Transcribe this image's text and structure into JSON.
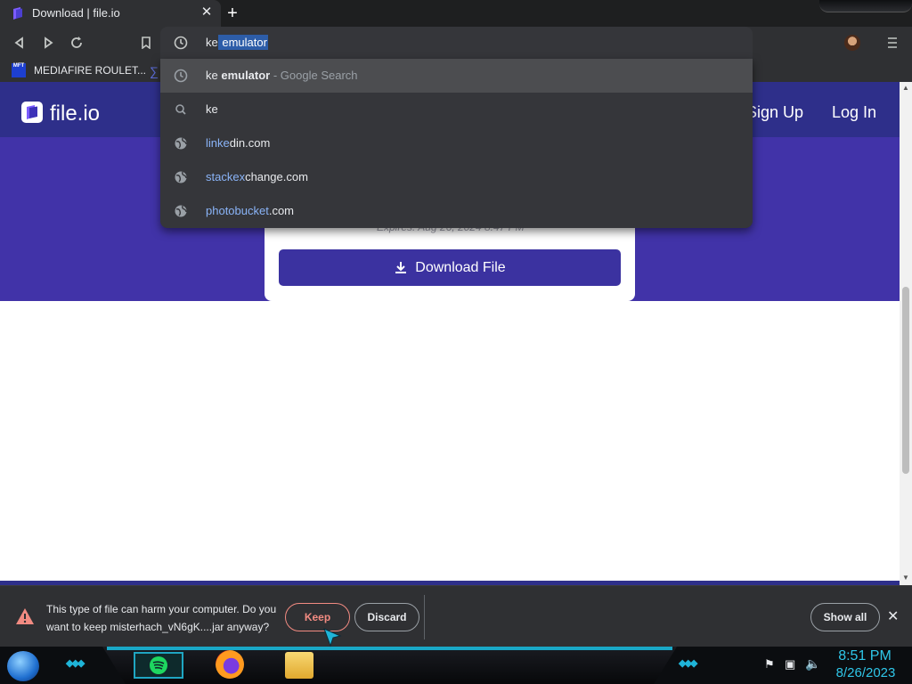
{
  "browser": {
    "tab": {
      "title": "Download | file.io",
      "close": "✕"
    },
    "new_tab": "+",
    "omnibox": {
      "typed": "ke",
      "autocomplete": " emulator"
    },
    "bookmarks": [
      {
        "label": "MEDIAFIRE ROULET...",
        "icon_text": "MFT"
      }
    ]
  },
  "suggestions": [
    {
      "icon": "history-icon",
      "pre": "ke ",
      "bold": "emulator",
      "sub": " - Google Search",
      "highlight": "",
      "rest": ""
    },
    {
      "icon": "search-icon",
      "pre": "ke",
      "bold": "",
      "sub": "",
      "highlight": "",
      "rest": ""
    },
    {
      "icon": "globe-icon",
      "pre": "",
      "bold": "",
      "sub": "",
      "highlight": "linke",
      "rest": "din.com"
    },
    {
      "icon": "globe-icon",
      "pre": "",
      "bold": "",
      "sub": "",
      "highlight": "stackex",
      "rest": "change.com"
    },
    {
      "icon": "globe-icon",
      "pre": "",
      "bold": "",
      "sub": "",
      "highlight": "photobucket",
      "rest": ".com"
    }
  ],
  "website": {
    "logo": "file.io",
    "nav": {
      "signup": "Sign Up",
      "login": "Log In"
    },
    "expires": "Expires: Aug 26, 2024 8:47 PM",
    "download_button": "Download File"
  },
  "download_bar": {
    "warning": "This type of file can harm your computer. Do you want to keep misterhach_vN6gK....jar anyway?",
    "keep": "Keep",
    "discard": "Discard",
    "show_all": "Show all",
    "close": "✕"
  },
  "taskbar": {
    "time": "8:51 PM",
    "date": "8/26/2023"
  },
  "colors": {
    "site_header": "#2e2f8a",
    "hero": "#4133a8",
    "button": "#3b32a0",
    "link_highlight": "#8ab4f8",
    "clock": "#2fc6e8"
  }
}
